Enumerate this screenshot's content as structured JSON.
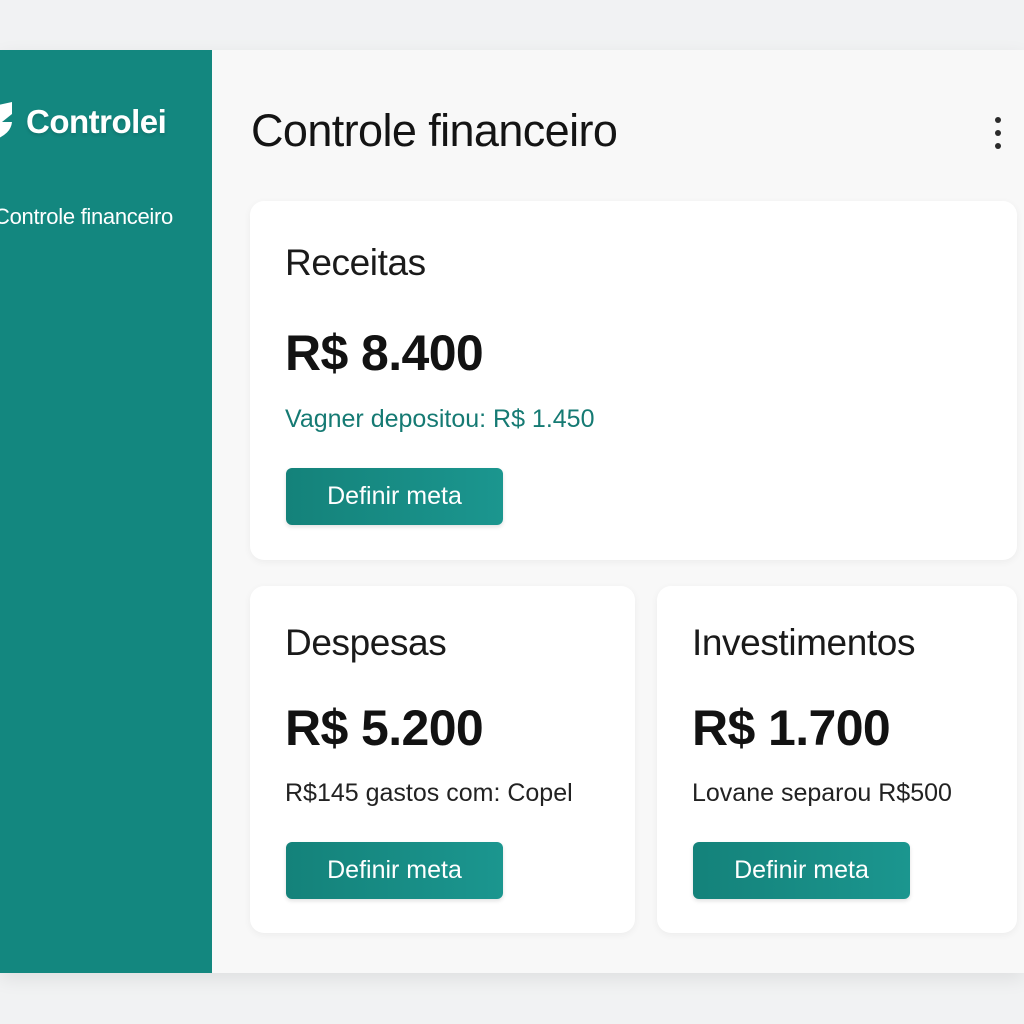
{
  "app": {
    "name": "Controlei",
    "logo_icon": "shield-icon"
  },
  "sidebar": {
    "items": [
      {
        "label": "Controle financeiro"
      }
    ]
  },
  "header": {
    "title": "Controle financeiro",
    "menu_icon": "kebab-menu-icon"
  },
  "cards": [
    {
      "title": "Receitas",
      "value": "R$ 8.400",
      "note": "Vagner depositou: R$ 1.450",
      "button": "Definir meta"
    },
    {
      "title": "Despesas",
      "value": "R$ 5.200",
      "note": "R$145 gastos com: Copel",
      "button": "Definir meta"
    },
    {
      "title": "Investimentos",
      "value": "R$ 1.700",
      "note": "Lovane separou R$500",
      "button": "Definir meta"
    }
  ],
  "colors": {
    "brand": "#13877f",
    "accent_text": "#157a73",
    "background": "#f8f8f8"
  }
}
